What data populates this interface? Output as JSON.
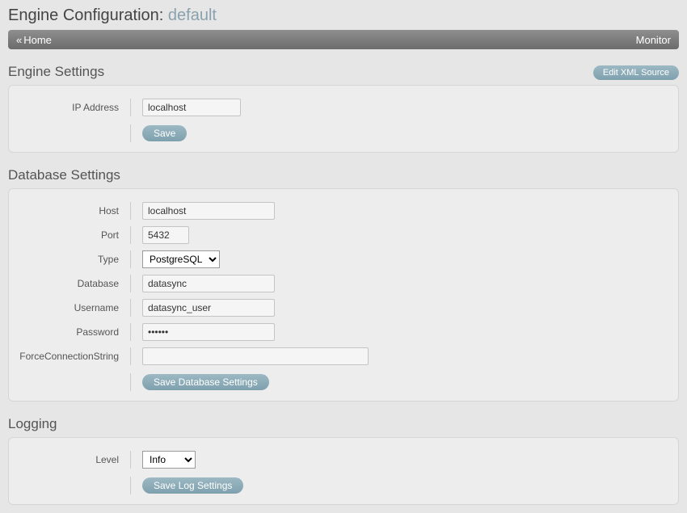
{
  "page": {
    "title_prefix": "Engine Configuration:",
    "title_suffix": "default"
  },
  "nav": {
    "home_label": "Home",
    "monitor_label": "Monitor"
  },
  "engine": {
    "section_title": "Engine Settings",
    "edit_xml_label": "Edit XML Source",
    "ip_label": "IP Address",
    "ip_value": "localhost",
    "save_label": "Save"
  },
  "database": {
    "section_title": "Database Settings",
    "host_label": "Host",
    "host_value": "localhost",
    "port_label": "Port",
    "port_value": "5432",
    "type_label": "Type",
    "type_value": "PostgreSQL",
    "database_label": "Database",
    "database_value": "datasync",
    "username_label": "Username",
    "username_value": "datasync_user",
    "password_label": "Password",
    "password_value": "••••••",
    "fcs_label": "ForceConnectionString",
    "fcs_value": "",
    "save_label": "Save Database Settings"
  },
  "logging": {
    "section_title": "Logging",
    "level_label": "Level",
    "level_value": "Info",
    "save_label": "Save Log Settings"
  }
}
